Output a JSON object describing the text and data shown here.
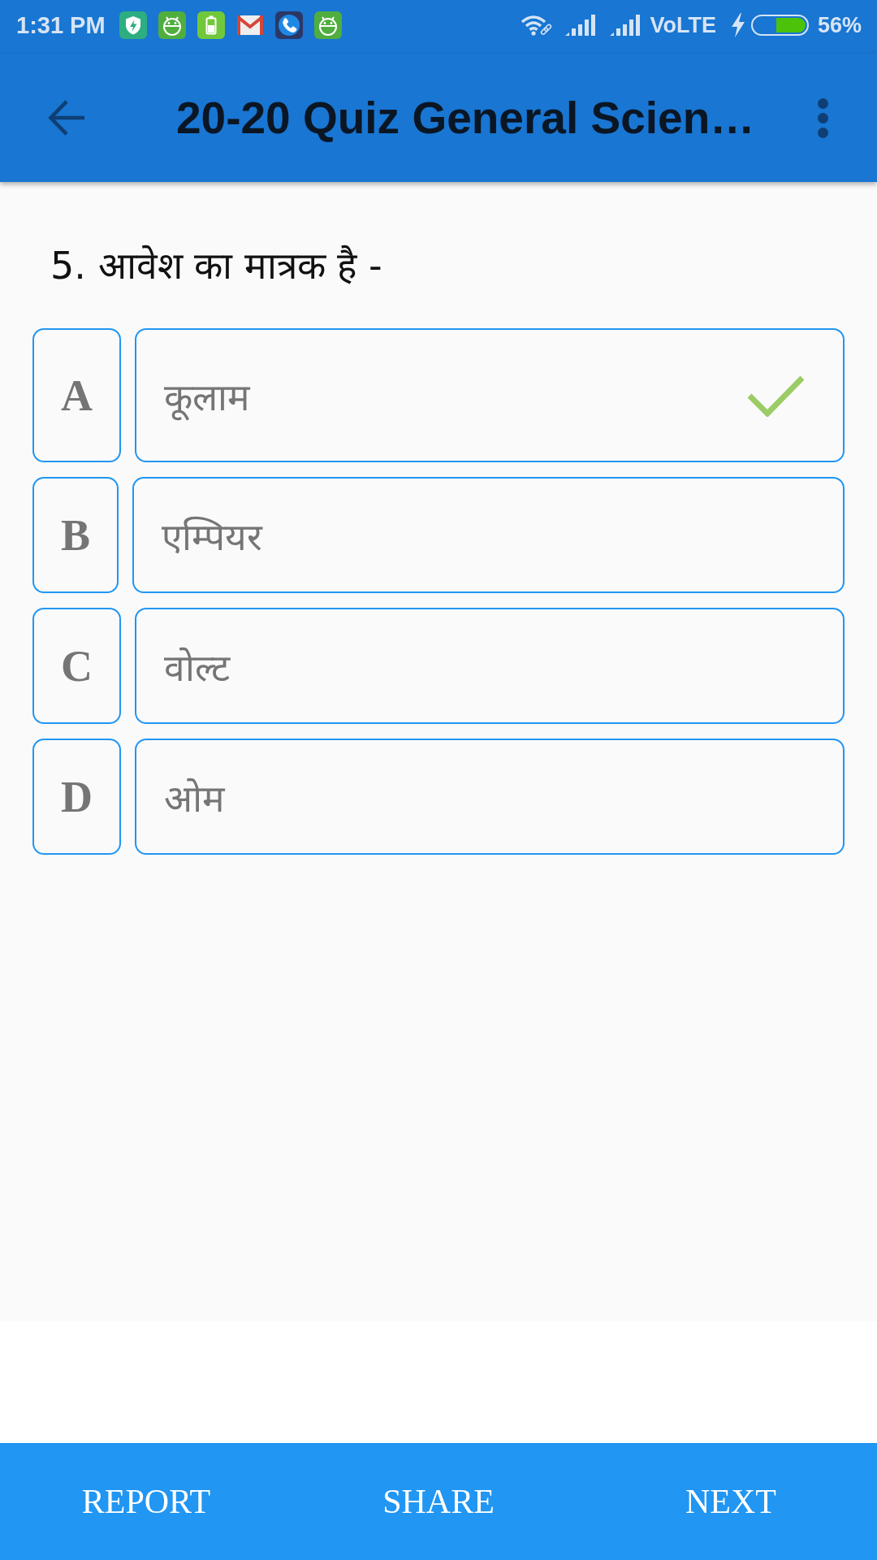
{
  "status_bar": {
    "time": "1:31 PM",
    "network": "VoLTE",
    "battery": "56%"
  },
  "app_bar": {
    "title": "20-20 Quiz General Scien…"
  },
  "question": {
    "text": "5. आवेश का मात्रक है -"
  },
  "options": [
    {
      "letter": "A",
      "text": "कूलाम",
      "correct": true
    },
    {
      "letter": "B",
      "text": "एम्पियर",
      "correct": false
    },
    {
      "letter": "C",
      "text": "वोल्ट",
      "correct": false
    },
    {
      "letter": "D",
      "text": "ओम",
      "correct": false
    }
  ],
  "bottom_bar": {
    "buttons": [
      "REPORT",
      "SHARE",
      "NEXT"
    ]
  }
}
